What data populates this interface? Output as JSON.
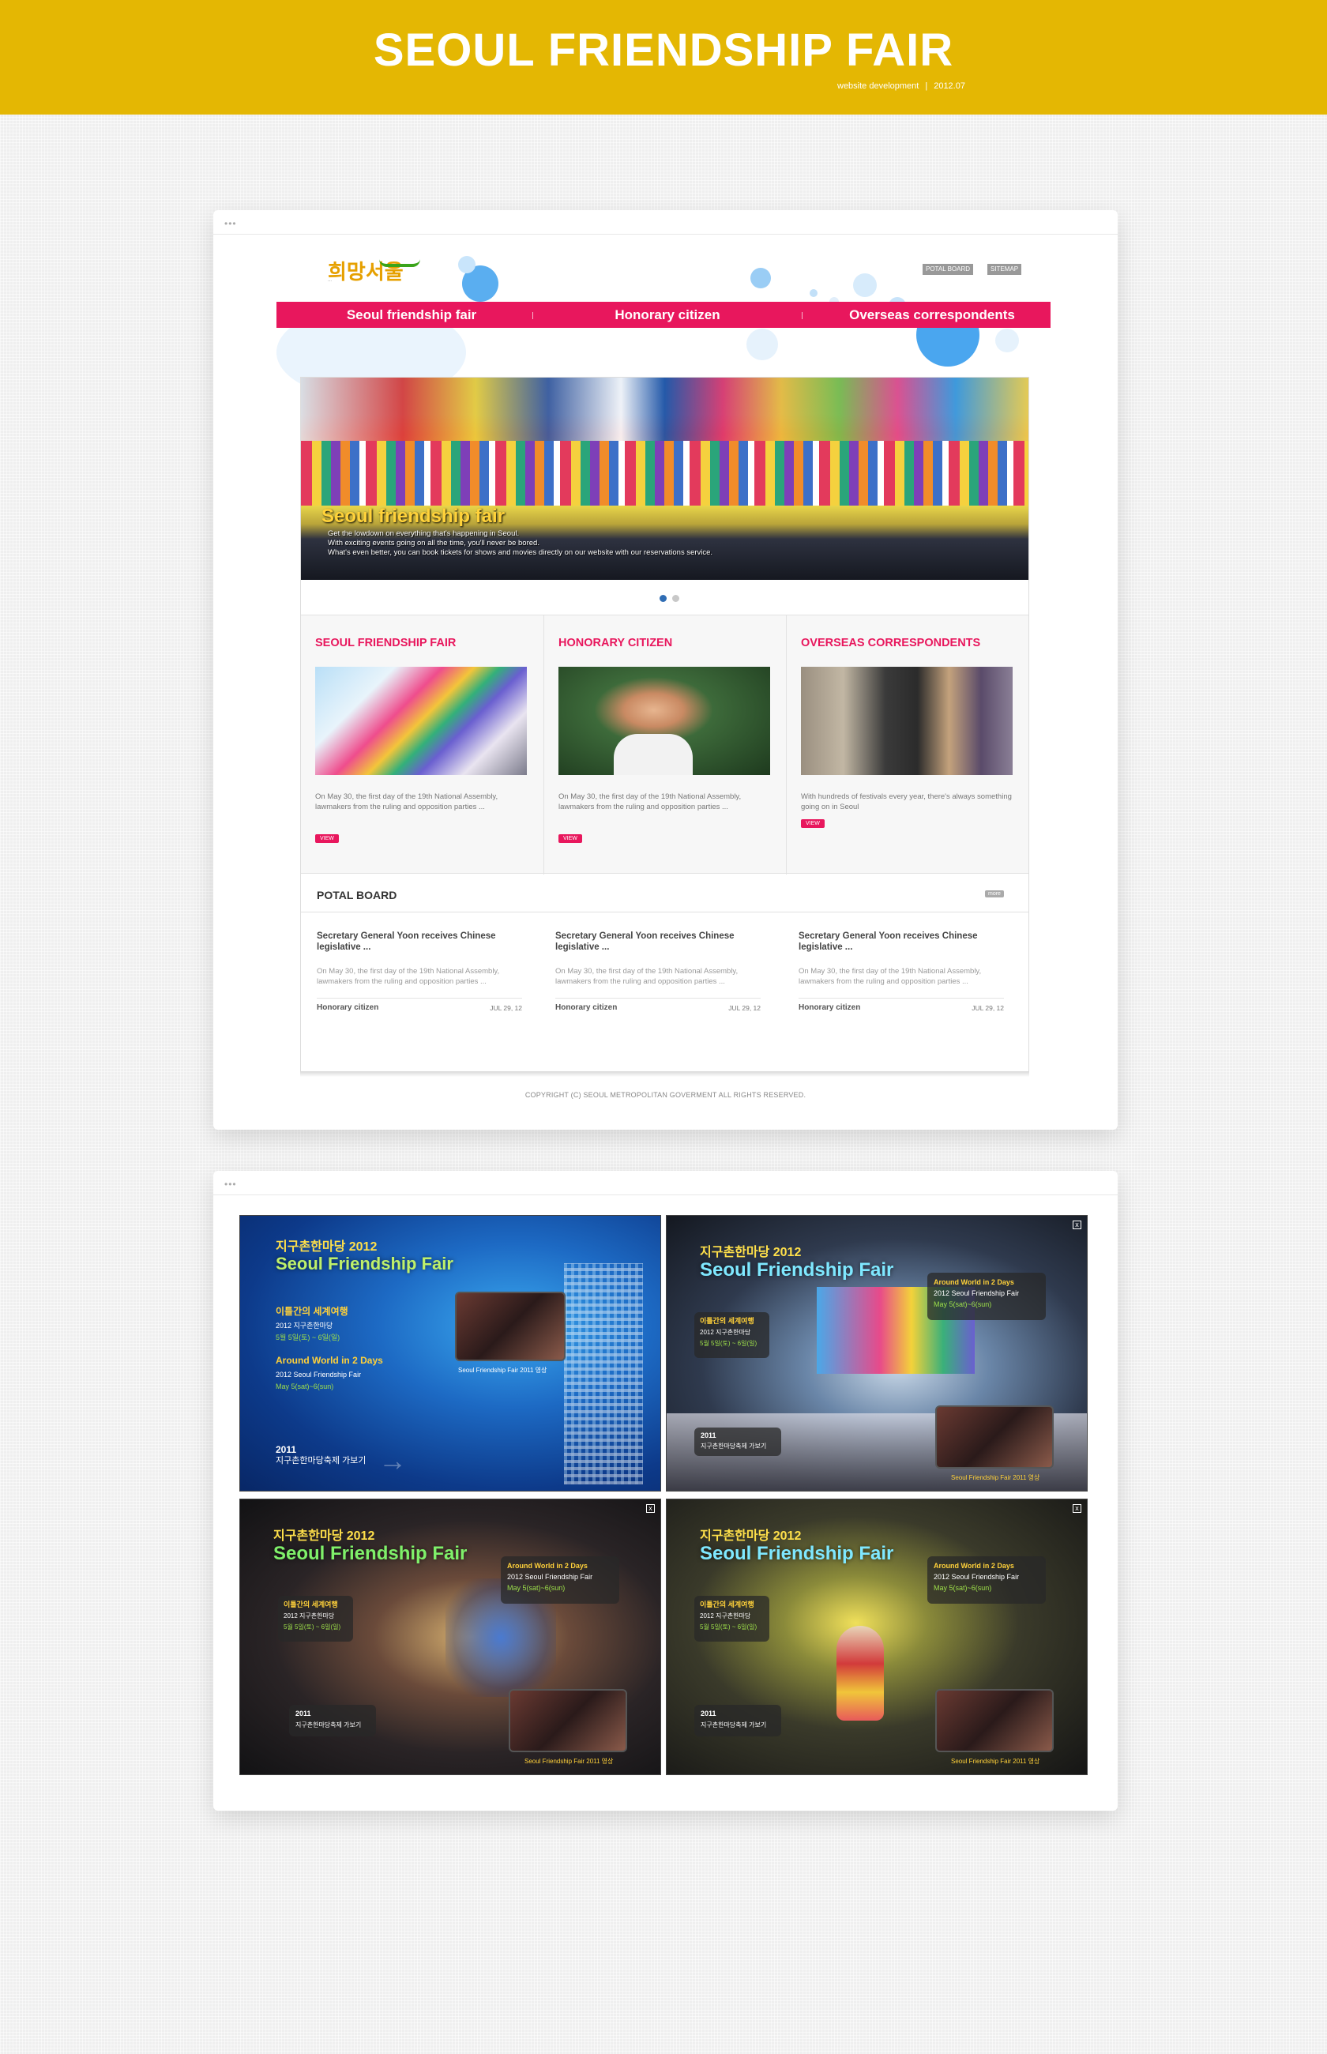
{
  "header": {
    "title": "SEOUL FRIENDSHIP FAIR",
    "meta_left": "website development",
    "meta_sep": "|",
    "meta_right": "2012.07"
  },
  "colors": {
    "header_bg": "#e4b703",
    "accent_pink": "#e8175d",
    "frame_bg": "#ffffff"
  },
  "frame_dots": "•••",
  "site": {
    "logo_text": "희망서울",
    "logo_small": "...",
    "top_buttons": [
      "POTAL BOARD",
      "SITEMAP"
    ],
    "nav": [
      "Seoul friendship fair",
      "Honorary citizen",
      "Overseas correspondents"
    ],
    "hero": {
      "title": "Seoul friendship fair",
      "line1": "Get the lowdown on everything that's happening in Seoul.",
      "line2": "With exciting events going on all the time, you'll never be bored.",
      "line3": "What's even better, you can book tickets for shows and movies directly on our website with our reservations service."
    },
    "columns": [
      {
        "title": "SEOUL FRIENDSHIP FAIR",
        "text": "On May 30, the first day of the 19th National Assembly, lawmakers from the ruling and opposition parties ...",
        "button": "VIEW"
      },
      {
        "title": "HONORARY CITIZEN",
        "text": "On May 30, the first day of the 19th National Assembly, lawmakers from the ruling and opposition parties ...",
        "button": "VIEW"
      },
      {
        "title": "OVERSEAS CORRESPONDENTS",
        "text": "With hundreds of festivals every year, there's always something going on in Seoul",
        "button": "VIEW"
      }
    ],
    "board": {
      "title": "POTAL BOARD",
      "more": "more",
      "posts": [
        {
          "title": "Secretary General Yoon receives Chinese legislative ...",
          "text": "On May 30, the first day of the 19th National Assembly, lawmakers from the ruling and opposition parties ...",
          "category": "Honorary citizen",
          "date": "JUL 29, 12"
        },
        {
          "title": "Secretary General Yoon receives Chinese legislative ...",
          "text": "On May 30, the first day of the 19th National Assembly, lawmakers from the ruling and opposition parties ...",
          "category": "Honorary citizen",
          "date": "JUL 29, 12"
        },
        {
          "title": "Secretary General Yoon receives Chinese legislative ...",
          "text": "On May 30, the first day of the 19th National Assembly, lawmakers from the ruling and opposition parties ...",
          "category": "Honorary citizen",
          "date": "JUL 29, 12"
        }
      ]
    },
    "copyright": "COPYRIGHT (C) SEOUL METROPOLITAN GOVERMENT ALL RIGHTS RESERVED."
  },
  "panels": {
    "kr_title": "지구촌한마당 2012",
    "en_title": "Seoul Friendship Fair",
    "kr_trip": "이틀간의 세계여행",
    "kr_event": "2012 지구촌한마당",
    "kr_date": "5월 5일(토) ~ 6일(일)",
    "around": "Around World in 2 Days",
    "en_event": "2012 Seoul Friendship Fair",
    "en_date": "May 5(sat)~6(sun)",
    "year": "2011",
    "goto": "지구촌한마당축제 가보기",
    "video_label": "Seoul Friendship Fair 2011 영상",
    "close": "x"
  }
}
